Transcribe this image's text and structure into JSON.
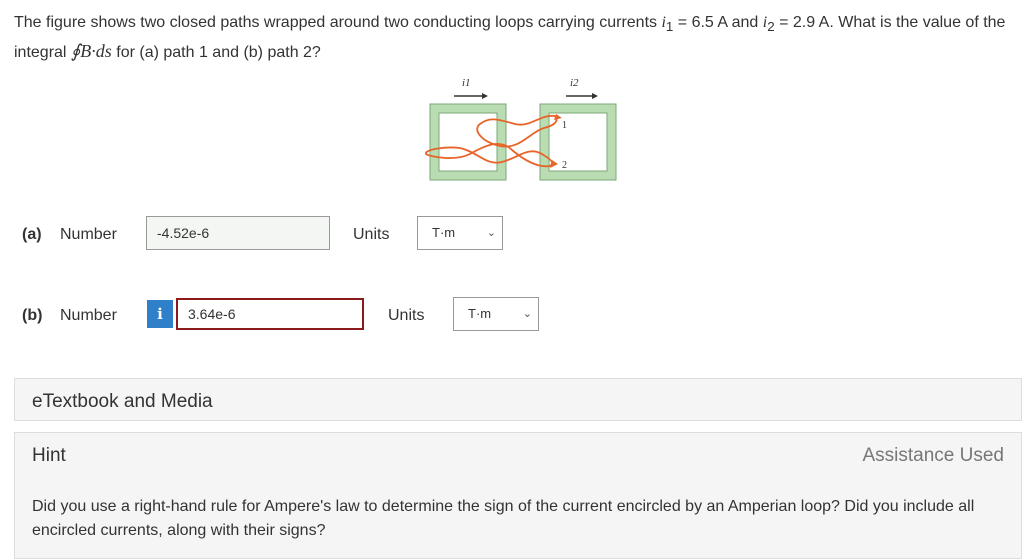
{
  "question": {
    "pre": "The figure shows two closed paths wrapped around two conducting loops carrying currents",
    "i1_sym": "i",
    "i1_sub": "1",
    "i1_val": " = 6.5 A and ",
    "i2_sym": "i",
    "i2_sub": "2",
    "i2_val": " = 2.9 A. What is the value of the integral ",
    "integral": "∮B·ds",
    "post": " for (a) path 1 and (b) path 2?"
  },
  "figure": {
    "label_i1": "i1",
    "label_i2": "i2",
    "path1": "1",
    "path2": "2",
    "loop_fill": "#b9dcb3",
    "path_color": "#e8652a"
  },
  "part_a": {
    "label": "(a)",
    "number_label": "Number",
    "value": "-4.52e-6",
    "units_label": "Units",
    "units_value": "T·m"
  },
  "part_b": {
    "label": "(b)",
    "number_label": "Number",
    "info_icon": "i",
    "value": "3.64e-6",
    "units_label": "Units",
    "units_value": "T·m"
  },
  "media": {
    "label": "eTextbook and Media"
  },
  "hint": {
    "label": "Hint",
    "status": "Assistance Used",
    "text": "Did you use a right-hand rule for Ampere's law to determine the sign of the current encircled by an Amperian loop? Did you include all encircled currents, along with their signs?"
  }
}
